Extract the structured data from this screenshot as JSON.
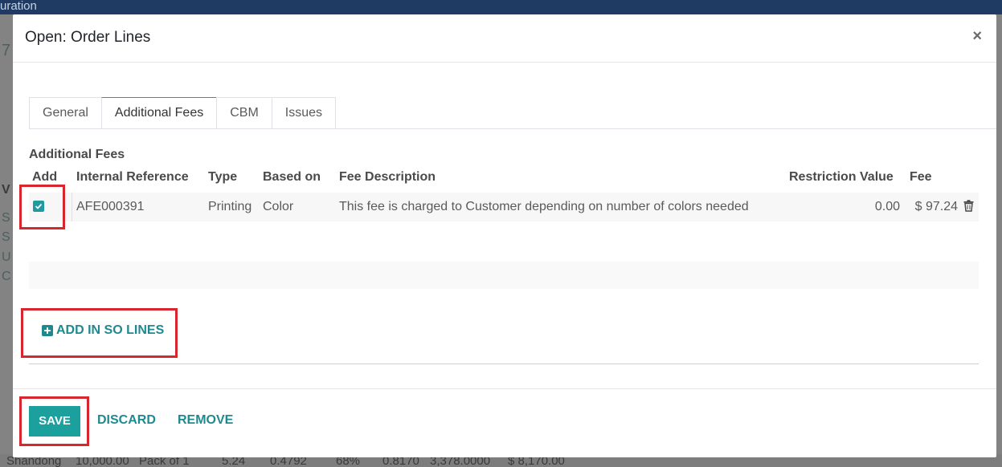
{
  "background": {
    "topbar_text": "uration",
    "left_chars": [
      "7",
      "V",
      "S",
      "S",
      "U",
      "C"
    ],
    "bottom_row": [
      "Shandong",
      "10,000.00",
      "Pack of 1",
      "5.24",
      "0.4792",
      "68%",
      "0.8170",
      "3,378.0000",
      "$ 8,170.00"
    ]
  },
  "modal": {
    "title": "Open: Order Lines",
    "close_label": "×",
    "tabs": [
      {
        "label": "General",
        "active": false
      },
      {
        "label": "Additional Fees",
        "active": true
      },
      {
        "label": "CBM",
        "active": false
      },
      {
        "label": "Issues",
        "active": false
      }
    ],
    "section_label": "Additional Fees",
    "columns": {
      "add": "Add",
      "internal_reference": "Internal Reference",
      "type": "Type",
      "based_on": "Based on",
      "fee_description": "Fee Description",
      "restriction_value": "Restriction Value",
      "fee": "Fee"
    },
    "rows": [
      {
        "checked": true,
        "internal_reference": "AFE000391",
        "type": "Printing",
        "based_on": "Color",
        "fee_description": "This fee is charged to Customer depending on number of colors needed",
        "restriction_value": "0.00",
        "fee": "$ 97.24"
      }
    ],
    "add_in_so_lines": "ADD IN SO LINES",
    "footer": {
      "save": "SAVE",
      "discard": "DISCARD",
      "remove": "REMOVE"
    }
  },
  "colors": {
    "accent": "#1e8a90",
    "save_button": "#1ca09e",
    "highlight": "#d8262f",
    "topbar": "#1f3b63"
  }
}
